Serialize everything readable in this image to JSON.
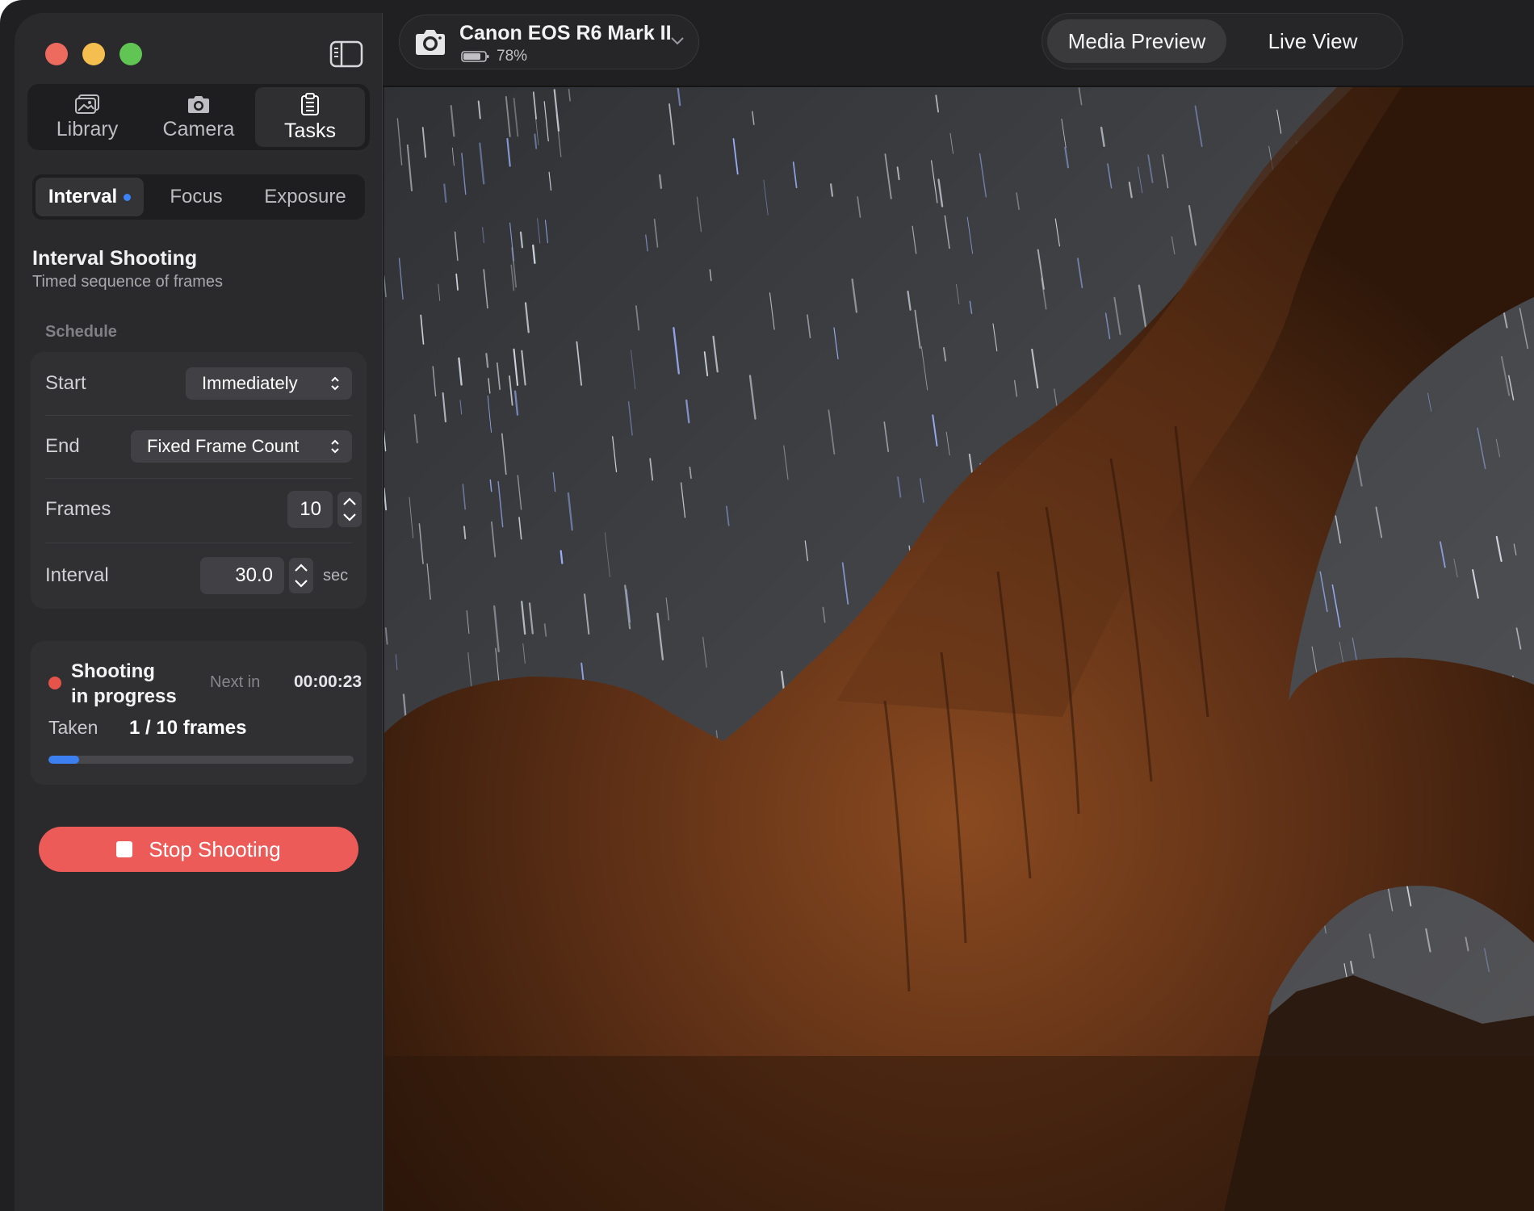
{
  "sidebar": {
    "main_tabs": [
      {
        "label": "Library",
        "icon": "photo-library-icon"
      },
      {
        "label": "Camera",
        "icon": "camera-icon"
      },
      {
        "label": "Tasks",
        "icon": "clipboard-icon"
      }
    ],
    "active_main_tab": "Tasks",
    "sub_tabs": [
      {
        "label": "Interval"
      },
      {
        "label": "Focus"
      },
      {
        "label": "Exposure"
      }
    ],
    "active_sub_tab": "Interval",
    "section": {
      "title": "Interval Shooting",
      "subtitle": "Timed sequence of frames",
      "group_label": "Schedule"
    },
    "settings": {
      "start_label": "Start",
      "start_value": "Immediately",
      "end_label": "End",
      "end_value": "Fixed Frame Count",
      "frames_label": "Frames",
      "frames_value": "10",
      "interval_label": "Interval",
      "interval_value": "30.0",
      "interval_unit": "sec"
    },
    "status": {
      "line1": "Shooting",
      "line2": "in progress",
      "next_label": "Next in",
      "next_value": "00:00:23",
      "taken_label": "Taken",
      "taken_value": "1 / 10 frames",
      "progress_fraction": 0.1
    },
    "stop_button_label": "Stop Shooting"
  },
  "topbar": {
    "device_name": "Canon EOS R6 Mark II",
    "battery": "78%",
    "view_options": [
      "Media Preview",
      "Live View"
    ],
    "active_view": "Media Preview"
  },
  "colors": {
    "accent_blue": "#3b7ff0",
    "stop_red": "#ec5b58",
    "recording_red": "#e5534b"
  }
}
